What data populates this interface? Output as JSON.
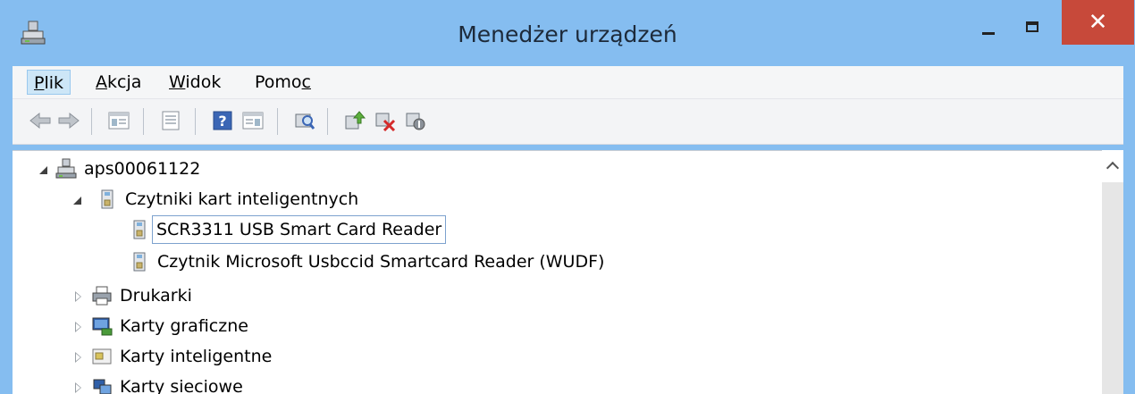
{
  "window": {
    "title": "Menedżer urządzeń",
    "accent": "#85bdf0",
    "close_color": "#c7493a",
    "close_glyph": "✕",
    "icon": "device-manager-icon"
  },
  "menu": {
    "items": [
      {
        "label": "Plik",
        "active": true
      },
      {
        "label": "Akcja",
        "active": false
      },
      {
        "label": "Widok",
        "active": false
      },
      {
        "label": "Pomoc",
        "active": false
      }
    ]
  },
  "toolbar": {
    "buttons": [
      "back-arrow-icon",
      "forward-arrow-icon",
      "console-tree-icon",
      "properties-icon",
      "help-icon",
      "action-pane-icon",
      "scan-hardware-icon",
      "update-driver-icon",
      "uninstall-device-icon",
      "disable-device-icon"
    ]
  },
  "tree": {
    "items": [
      {
        "label": "aps00061122",
        "icon": "computer-icon",
        "expanded": true
      },
      {
        "label": "Czytniki kart inteligentnych",
        "icon": "smartcard-reader-icon",
        "expanded": true
      },
      {
        "label": "SCR3311 USB Smart Card Reader",
        "icon": "smartcard-reader-icon",
        "selected": true
      },
      {
        "label": "Czytnik Microsoft Usbccid Smartcard Reader (WUDF)",
        "icon": "smartcard-reader-icon"
      },
      {
        "label": "Drukarki",
        "icon": "printer-icon",
        "expanded": false
      },
      {
        "label": "Karty graficzne",
        "icon": "display-adapter-icon",
        "expanded": false
      },
      {
        "label": "Karty inteligentne",
        "icon": "smart-card-icon",
        "expanded": false
      },
      {
        "label": "Karty sieciowe",
        "icon": "network-adapter-icon",
        "expanded": false
      }
    ]
  }
}
